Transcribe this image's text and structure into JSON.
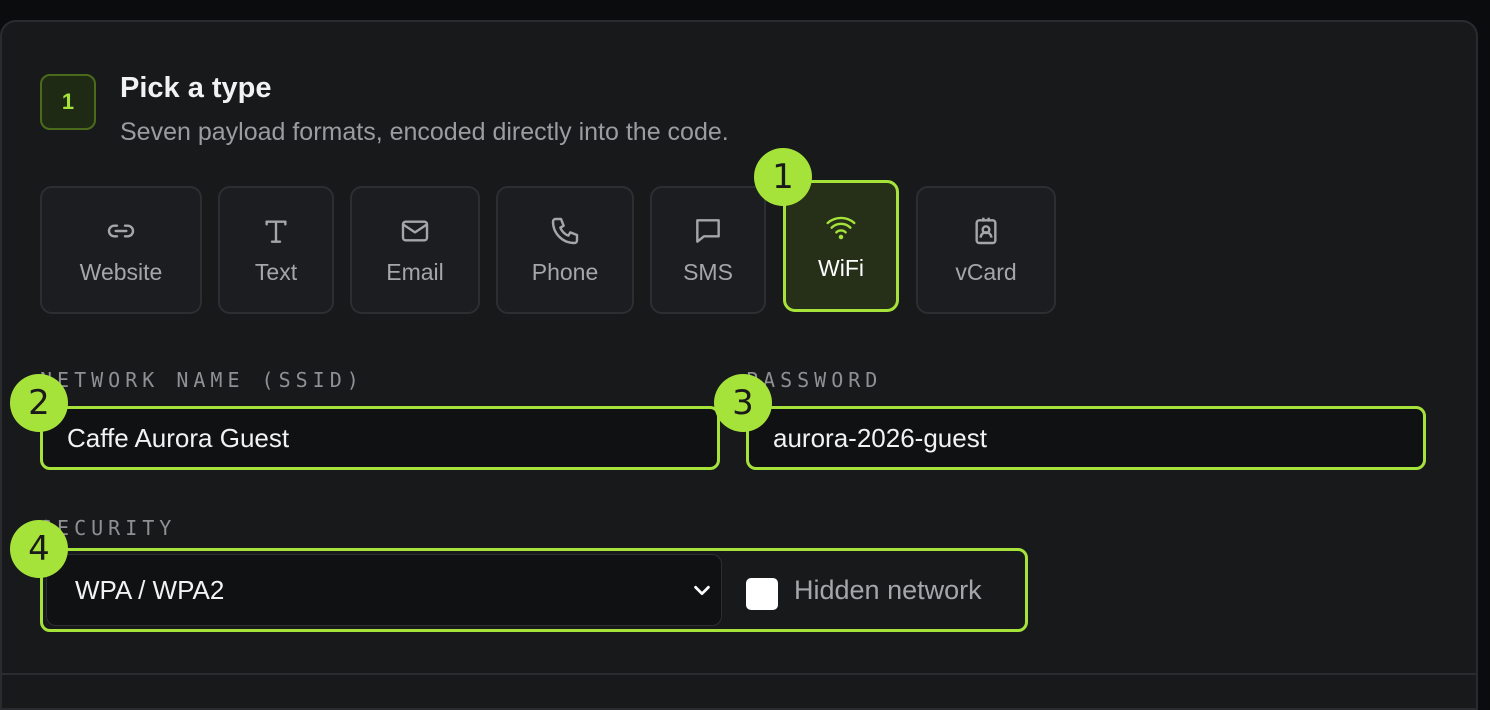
{
  "step": {
    "number": "1",
    "title": "Pick a type",
    "subtitle": "Seven payload formats, encoded directly into the code."
  },
  "types": [
    {
      "label": "Website",
      "icon": "link-icon"
    },
    {
      "label": "Text",
      "icon": "text-icon"
    },
    {
      "label": "Email",
      "icon": "mail-icon"
    },
    {
      "label": "Phone",
      "icon": "phone-icon"
    },
    {
      "label": "SMS",
      "icon": "message-icon"
    },
    {
      "label": "WiFi",
      "icon": "wifi-icon",
      "selected": true
    },
    {
      "label": "vCard",
      "icon": "contact-card-icon"
    }
  ],
  "wifi": {
    "ssid_label": "NETWORK NAME (SSID)",
    "ssid_value": "Caffe Aurora Guest",
    "password_label": "PASSWORD",
    "password_value": "aurora-2026-guest",
    "security_label": "SECURITY",
    "security_value": "WPA / WPA2",
    "hidden_label": "Hidden network",
    "hidden_checked": false
  },
  "markers": [
    "1",
    "2",
    "3",
    "4"
  ],
  "colors": {
    "accent": "#a6e33a",
    "background": "#18191b",
    "input_bg": "#101113"
  }
}
